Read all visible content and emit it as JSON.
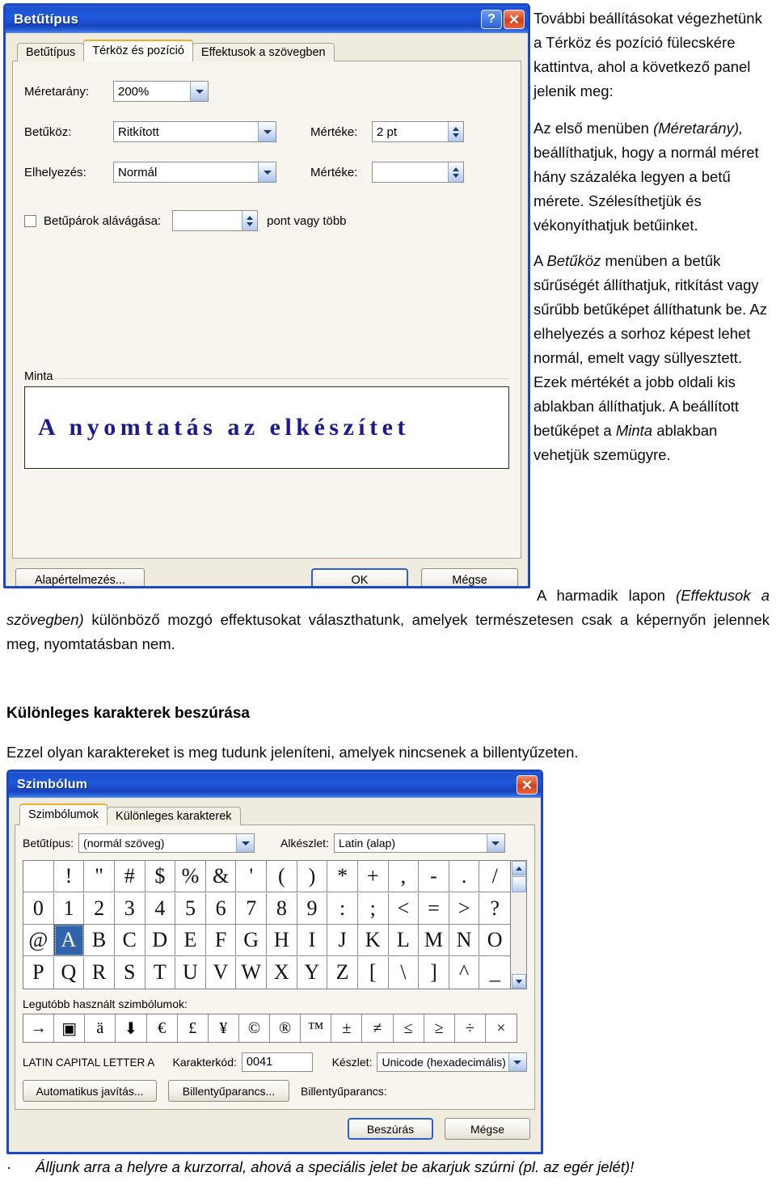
{
  "font_dialog": {
    "title": "Betűtípus",
    "titlebar_buttons": [
      {
        "name": "help-button",
        "glyph": "?"
      },
      {
        "name": "close-button",
        "glyph": "✕"
      }
    ],
    "tabs": [
      {
        "label": "Betűtípus",
        "active": false
      },
      {
        "label": "Térköz és pozíció",
        "active": true
      },
      {
        "label": "Effektusok a szövegben",
        "active": false
      }
    ],
    "fields": {
      "scale_label": "Méretarány:",
      "scale_value": "200%",
      "spacing_label": "Betűköz:",
      "spacing_value": "Ritkított",
      "spacing_amount_label": "Mértéke:",
      "spacing_amount_value": "2 pt",
      "position_label": "Elhelyezés:",
      "position_value": "Normál",
      "position_amount_label": "Mértéke:",
      "position_amount_value": "",
      "kerning_label": "Betűpárok alávágása:",
      "kerning_value": "",
      "kerning_suffix": "pont vagy több"
    },
    "preview": {
      "legend": "Minta",
      "sample_text": "A nyomtatás az elkészítet"
    },
    "buttons": {
      "defaults": "Alapértelmezés...",
      "ok": "OK",
      "cancel": "Mégse"
    }
  },
  "side_text": {
    "p1": "További beállításokat végezhetünk a Térköz és pozíció fülecskére kattintva, ahol a következő panel jelenik meg:",
    "p2_a": "Az első menüben ",
    "p2_em": "(Méretarány),",
    "p2_b": " beállíthatjuk, hogy a normál méret hány százaléka legyen a betű mérete. Szélesíthetjük és vékonyíthatjuk betűinket.",
    "p3_a": "A ",
    "p3_em1": "Betűköz",
    "p3_b": " menüben a betűk sűrűségét állíthatjuk, ritkítást vagy sűrűbb betűképet állíthatunk be. Az elhelyezés a sorhoz képest lehet normál, emelt vagy süllyesztett. Ezek mértékét a jobb oldali kis ablakban állíthatjuk. A beállított betűképet a ",
    "p3_em2": "Minta",
    "p3_c": " ablakban vehetjük szemügyre."
  },
  "body_text": {
    "p4_a": "A harmadik lapon ",
    "p4_em": "(Effektusok a szövegben)",
    "p4_b": " különböző mozgó effektusokat választhatunk, amelyek természetesen csak a képernyőn jelennek meg, nyomtatásban nem.",
    "heading": "Különleges karakterek beszúrása",
    "p5": "Ezzel olyan karaktereket is meg tudunk jeleníteni, amelyek nincsenek a billentyűzeten.",
    "bullet_marker": "·",
    "bullet_text": "Álljunk arra a helyre a kurzorral, ahová a speciális jelet be akarjuk szúrni (pl. az egér jelét)!"
  },
  "symbol_dialog": {
    "title": "Szimbólum",
    "close_glyph": "✕",
    "tabs": [
      {
        "label": "Szimbólumok",
        "active": true
      },
      {
        "label": "Különleges karakterek",
        "active": false
      }
    ],
    "font_label": "Betűtípus:",
    "font_value": "(normál szöveg)",
    "subset_label": "Alkészlet:",
    "subset_value": "Latin (alap)",
    "grid_rows": [
      [
        " ",
        "!",
        "\"",
        "#",
        "$",
        "%",
        "&",
        "'",
        "(",
        ")",
        "*",
        "+",
        ",",
        "-",
        ".",
        "/"
      ],
      [
        "0",
        "1",
        "2",
        "3",
        "4",
        "5",
        "6",
        "7",
        "8",
        "9",
        ":",
        ";",
        "<",
        "=",
        ">",
        "?"
      ],
      [
        "@",
        "A",
        "B",
        "C",
        "D",
        "E",
        "F",
        "G",
        "H",
        "I",
        "J",
        "K",
        "L",
        "M",
        "N",
        "O"
      ],
      [
        "P",
        "Q",
        "R",
        "S",
        "T",
        "U",
        "V",
        "W",
        "X",
        "Y",
        "Z",
        "[",
        "\\",
        "]",
        "^",
        "_"
      ]
    ],
    "selected_char": "A",
    "selected_row": 2,
    "selected_col": 1,
    "recent_label": "Legutóbb használt szimbólumok:",
    "recent_symbols": [
      "→",
      "▣",
      "ä",
      "⬇",
      "€",
      "£",
      "¥",
      "©",
      "®",
      "™",
      "±",
      "≠",
      "≤",
      "≥",
      "÷",
      "×"
    ],
    "char_name": "LATIN CAPITAL LETTER A",
    "charcode_label": "Karakterkód:",
    "charcode_value": "0041",
    "set_label": "Készlet:",
    "set_value": "Unicode (hexadecimális)",
    "autocorrect_button": "Automatikus javítás...",
    "shortcut_button": "Billentyűparancs...",
    "shortcut_label": "Billentyűparancs:",
    "insert_button": "Beszúrás",
    "cancel_button": "Mégse"
  }
}
